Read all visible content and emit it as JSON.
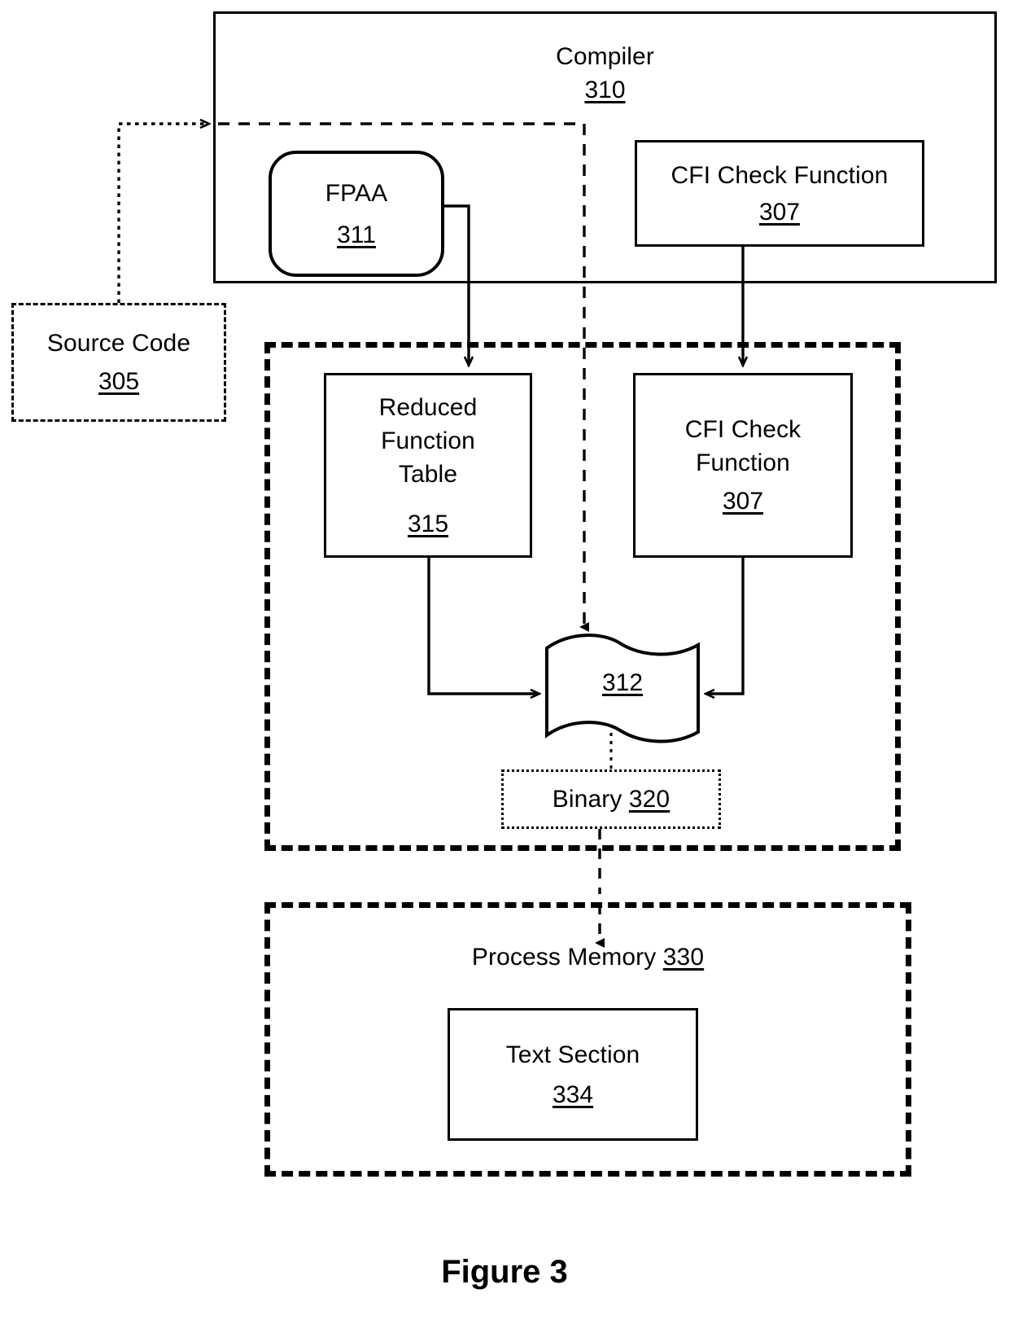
{
  "figure": {
    "caption": "Figure 3"
  },
  "compiler": {
    "title": "Compiler",
    "ref": "310",
    "fpaa": {
      "title": "FPAA",
      "ref": "311"
    },
    "cfi_check": {
      "title": "CFI Check Function",
      "ref": "307"
    }
  },
  "source_code": {
    "title": "Source Code",
    "ref": "305"
  },
  "artifacts": {
    "reduced_function_table": {
      "line1": "Reduced",
      "line2": "Function",
      "line3": "Table",
      "ref": "315"
    },
    "cfi_check_function": {
      "line1": "CFI Check",
      "line2": "Function",
      "ref": "307"
    },
    "object_file": {
      "ref": "312"
    },
    "binary": {
      "label": "Binary",
      "ref": "320"
    }
  },
  "process_memory": {
    "title": "Process Memory",
    "ref": "330",
    "text_section": {
      "title": "Text Section",
      "ref": "334"
    }
  },
  "colors": {
    "stroke": "#000000",
    "background": "#ffffff"
  }
}
